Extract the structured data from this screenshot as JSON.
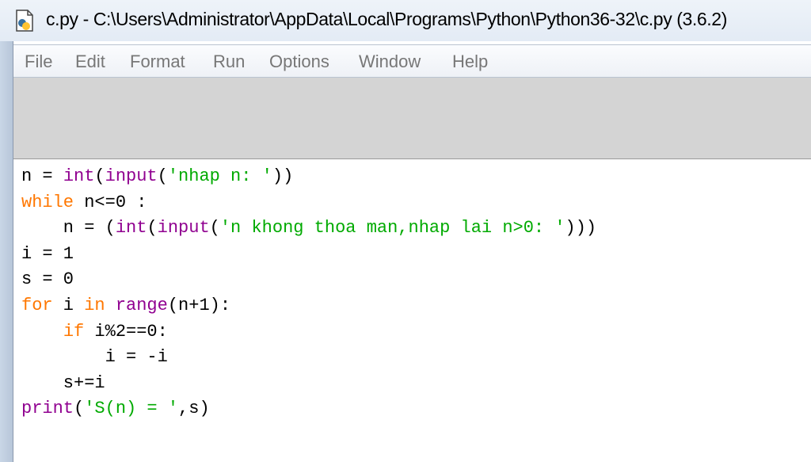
{
  "window": {
    "title": "c.py - C:\\Users\\Administrator\\AppData\\Local\\Programs\\Python\\Python36-32\\c.py (3.6.2)"
  },
  "menu": [
    "File",
    "Edit",
    "Format",
    "Run",
    "Options",
    "Window",
    "Help"
  ],
  "code_lines": [
    [
      {
        "t": "n = ",
        "c": "plain"
      },
      {
        "t": "int",
        "c": "bi"
      },
      {
        "t": "(",
        "c": "plain"
      },
      {
        "t": "input",
        "c": "bi"
      },
      {
        "t": "(",
        "c": "plain"
      },
      {
        "t": "'nhap n: '",
        "c": "str"
      },
      {
        "t": "))",
        "c": "plain"
      }
    ],
    [
      {
        "t": "while",
        "c": "kw"
      },
      {
        "t": " n<=0 :",
        "c": "plain"
      }
    ],
    [
      {
        "t": "    n = (",
        "c": "plain"
      },
      {
        "t": "int",
        "c": "bi"
      },
      {
        "t": "(",
        "c": "plain"
      },
      {
        "t": "input",
        "c": "bi"
      },
      {
        "t": "(",
        "c": "plain"
      },
      {
        "t": "'n khong thoa man,nhap lai n>0: '",
        "c": "str"
      },
      {
        "t": ")))",
        "c": "plain"
      }
    ],
    [
      {
        "t": "i = 1",
        "c": "plain"
      }
    ],
    [
      {
        "t": "s = 0",
        "c": "plain"
      }
    ],
    [
      {
        "t": "for",
        "c": "kw"
      },
      {
        "t": " i ",
        "c": "plain"
      },
      {
        "t": "in",
        "c": "kw"
      },
      {
        "t": " ",
        "c": "plain"
      },
      {
        "t": "range",
        "c": "bi"
      },
      {
        "t": "(n+1):",
        "c": "plain"
      }
    ],
    [
      {
        "t": "    ",
        "c": "plain"
      },
      {
        "t": "if",
        "c": "kw"
      },
      {
        "t": " i%2==0:",
        "c": "plain"
      }
    ],
    [
      {
        "t": "        i = -i",
        "c": "plain"
      }
    ],
    [
      {
        "t": "    s+=i",
        "c": "plain"
      }
    ],
    [
      {
        "t": "print",
        "c": "bi"
      },
      {
        "t": "(",
        "c": "plain"
      },
      {
        "t": "'S(n) = '",
        "c": "str"
      },
      {
        "t": ",s)",
        "c": "plain"
      }
    ]
  ]
}
